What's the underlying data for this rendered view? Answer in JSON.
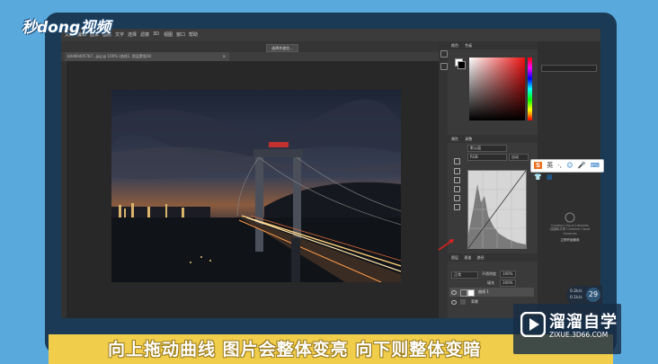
{
  "watermark_logo": "秒dong视频",
  "photoshop": {
    "document_tab": "b0d60d057b7...jpg @ 100% (曲线1, 图层蒙版/8)",
    "options_button": "选择并遮住...",
    "menu_items": [
      "文件",
      "编辑",
      "图像",
      "图层",
      "文字",
      "选择",
      "滤镜",
      "3D",
      "视图",
      "窗口",
      "帮助"
    ],
    "color_panel_tabs": [
      "颜色",
      "色板"
    ],
    "properties_tabs": [
      "属性",
      "调整"
    ],
    "properties_preset": "默认值",
    "properties_channel": "RGB",
    "properties_auto": "自动",
    "layers_tabs": [
      "图层",
      "通道",
      "路径"
    ],
    "layers_kind": "正常",
    "layers_opacity_label": "不透明度",
    "layers_opacity": "100%",
    "layers_fill_label": "填充",
    "layers_fill": "100%",
    "layers": [
      {
        "name": "曲线 1"
      },
      {
        "name": "背景"
      }
    ],
    "cc_text": [
      "Creative Cloud Libraries",
      "创建和共享 Creative Cloud Libraries"
    ],
    "cc_button": "立即开始使用"
  },
  "ime_toolbar": {
    "logo": "S",
    "items": [
      "英",
      "·,",
      "☺",
      "🎤",
      "⌨",
      "👕",
      "▦"
    ]
  },
  "network_badge": {
    "up": "0.2k/s",
    "down": "0.1k/s",
    "percent": "29"
  },
  "brand": {
    "name": "溜溜自学",
    "url": "ZIXUE.3D66.COM"
  },
  "subtitle": "向上拖动曲线 图片会整体变亮 向下则整体变暗",
  "colors": {
    "background": "#5aa9dc",
    "subtitle_band": "#f1cd4c",
    "ps_dark": "#2b2b2b"
  }
}
